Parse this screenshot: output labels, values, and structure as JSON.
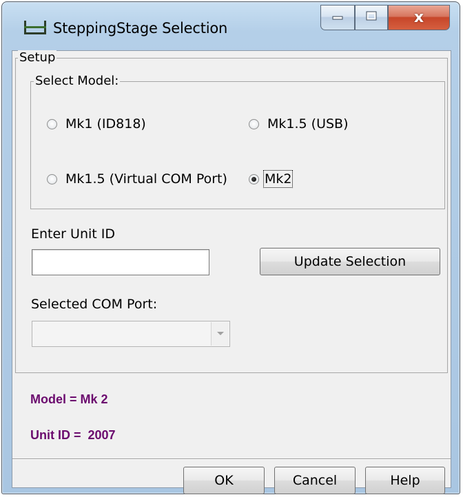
{
  "window": {
    "title": "SteppingStage Selection",
    "close_glyph": "x"
  },
  "setup_group": {
    "legend": "Setup",
    "model_group": {
      "legend": "Select Model:",
      "options": [
        {
          "label": "Mk1 (ID818)",
          "checked": false
        },
        {
          "label": "Mk1.5 (USB)",
          "checked": false
        },
        {
          "label": "Mk1.5 (Virtual COM Port)",
          "checked": false
        },
        {
          "label": "Mk2",
          "checked": true
        }
      ]
    },
    "unit_id": {
      "label": "Enter Unit ID",
      "value": "",
      "placeholder": ""
    },
    "update_button": "Update Selection",
    "com_port": {
      "label": "Selected COM Port:",
      "value": ""
    }
  },
  "status": {
    "model": "Model = Mk 2",
    "unit_id": "Unit ID =  2007"
  },
  "buttons": {
    "ok": "OK",
    "cancel": "Cancel",
    "help": "Help"
  },
  "colors": {
    "status_text": "#6b0a6e",
    "close_button": "#c7462a",
    "titlebar": "#b4cfe8"
  },
  "icons": {
    "app": "stepping-stage-icon",
    "minimize": "minimize-icon",
    "maximize": "maximize-icon",
    "close": "close-icon",
    "dropdown": "chevron-down-icon"
  }
}
